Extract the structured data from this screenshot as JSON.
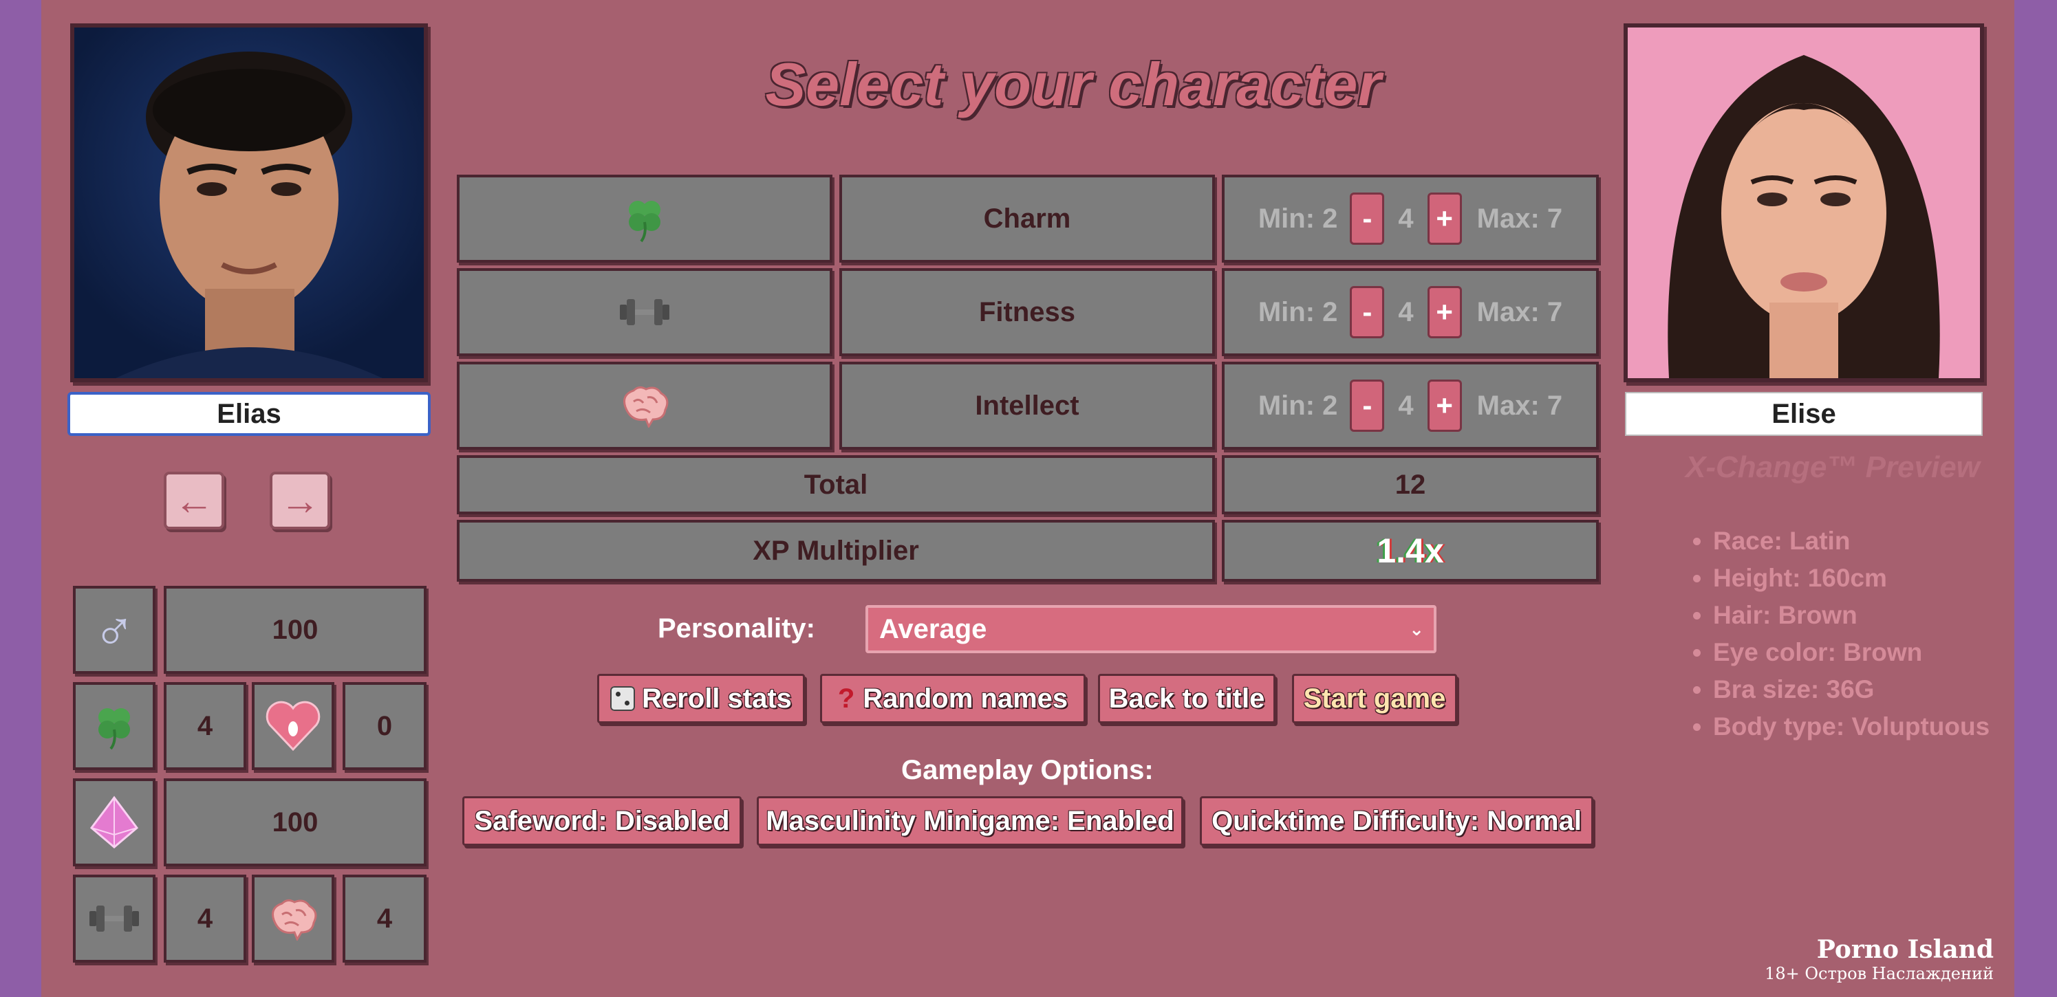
{
  "title": "Select your character",
  "male": {
    "name": "Elias",
    "prev_icon": "arrow-left-icon",
    "next_icon": "arrow-right-icon"
  },
  "female": {
    "name": "Elise"
  },
  "side_stats": {
    "masculinity": "100",
    "charm": "4",
    "arousal": "0",
    "energy": "100",
    "fitness": "4",
    "intellect": "4"
  },
  "stats": [
    {
      "icon": "clover-icon",
      "label": "Charm",
      "min": "Min: 2",
      "value": "4",
      "max": "Max: 7"
    },
    {
      "icon": "dumbbell-icon",
      "label": "Fitness",
      "min": "Min: 2",
      "value": "4",
      "max": "Max: 7"
    },
    {
      "icon": "brain-icon",
      "label": "Intellect",
      "min": "Min: 2",
      "value": "4",
      "max": "Max: 7"
    }
  ],
  "minus": "-",
  "plus": "+",
  "total": {
    "label": "Total",
    "value": "12"
  },
  "xp": {
    "label": "XP Multiplier",
    "value": "1.4x"
  },
  "personality": {
    "label": "Personality:",
    "value": "Average"
  },
  "buttons": {
    "reroll": "Reroll stats",
    "random": "Random names",
    "back": "Back to title",
    "start": "Start game"
  },
  "gameplay": {
    "heading": "Gameplay Options:",
    "safeword": "Safeword: Disabled",
    "minigame": "Masculinity Minigame: Enabled",
    "quicktime": "Quicktime Difficulty: Normal"
  },
  "preview": {
    "title": "X-Change™ Preview",
    "traits": [
      "Race: Latin",
      "Height: 160cm",
      "Hair: Brown",
      "Eye color: Brown",
      "Bra size: 36G",
      "Body type: Voluptuous"
    ]
  },
  "watermark": {
    "line1": "Porno Island",
    "line2": "18+ Остров Наслаждений"
  },
  "colors": {
    "background": "#a6606f",
    "panel": "#7d7d7d",
    "accent": "#d46d80"
  }
}
